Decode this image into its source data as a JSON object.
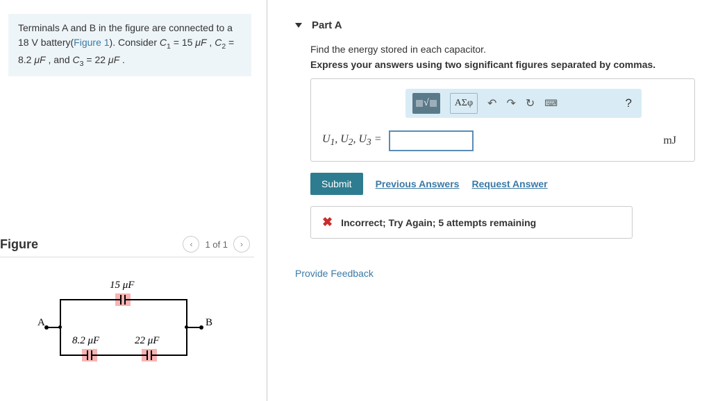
{
  "problem": {
    "line1_a": "Terminals A and B in the figure are connected to a ",
    "voltage": "18",
    "line1_b": " battery(",
    "figure_ref": "Figure 1",
    "line1_c": "). Consider ",
    "c1_name": "C",
    "c1_sub": "1",
    "c1_val": " = 15 ",
    "c1_unit": "μF",
    "sep1": " , ",
    "c2_name": "C",
    "c2_sub": "2",
    "c2_val": " = 8.2 ",
    "c2_unit": "μF",
    "sep2": " , and ",
    "c3_name": "C",
    "c3_sub": "3",
    "c3_val": " = 22 ",
    "c3_unit": "μF",
    "period": " ."
  },
  "figure": {
    "title": "Figure",
    "nav_text": "1 of 1",
    "cap1_label": "15 μF",
    "cap2_label": "8.2 μF",
    "cap3_label": "22 μF",
    "term_a": "A",
    "term_b": "B"
  },
  "part": {
    "title": "Part A",
    "instruction": "Find the energy stored in each capacitor.",
    "format": "Express your answers using two significant figures separated by commas."
  },
  "toolbar": {
    "greek_label": "ΑΣφ",
    "help": "?"
  },
  "answer": {
    "vars_label": "U₁, U₂, U₃ = ",
    "value": "",
    "unit": "mJ"
  },
  "actions": {
    "submit": "Submit",
    "previous": "Previous Answers",
    "request": "Request Answer"
  },
  "feedback": {
    "text": "Incorrect; Try Again; 5 attempts remaining"
  },
  "footer": {
    "provide": "Provide Feedback"
  }
}
